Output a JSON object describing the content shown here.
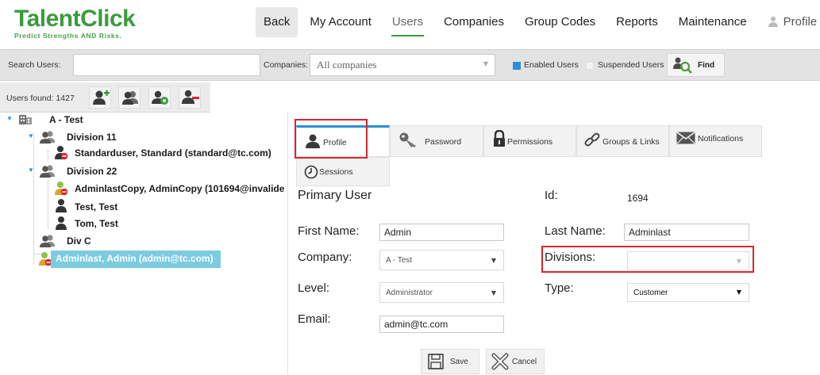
{
  "brand": {
    "name": "TalentClick",
    "tagline": "Predict Strengths AND Risks."
  },
  "nav": {
    "back": "Back",
    "items": [
      "My Account",
      "Users",
      "Companies",
      "Group Codes",
      "Reports",
      "Maintenance"
    ],
    "active": "Users",
    "profile": "Profile"
  },
  "search": {
    "label": "Search Users:",
    "value": "",
    "companies_label": "Companies:",
    "companies_value": "All companies",
    "enabled_label": "Enabled Users",
    "enabled_checked": true,
    "suspended_label": "Suspended Users",
    "suspended_checked": false,
    "find_label": "Find"
  },
  "users_found": "Users found: 1427",
  "toolbar_icons": [
    "add-user-icon",
    "users-icon",
    "user-settings-icon",
    "remove-user-icon"
  ],
  "tree": {
    "root": "A - Test",
    "divisions": [
      {
        "name": "Division 11",
        "users": [
          "Standarduser, Standard  (standard@tc.com)"
        ]
      },
      {
        "name": "Division 22",
        "users": [
          "AdminlastCopy, AdminCopy  (101694@invalide",
          "Test, Test",
          "Tom, Test"
        ]
      },
      {
        "name": "Div C",
        "users": []
      }
    ],
    "selected": "Adminlast, Admin  (admin@tc.com)"
  },
  "tabs": [
    "Profile",
    "Password",
    "Permissions",
    "Groups & Links",
    "Notifications",
    "Sessions"
  ],
  "active_tab": "Profile",
  "form": {
    "section_title": "Primary User",
    "id_label": "Id:",
    "id_value": "1694",
    "first_name_label": "First Name:",
    "first_name": "Admin",
    "last_name_label": "Last Name:",
    "last_name": "Adminlast",
    "company_label": "Company:",
    "company": "A - Test",
    "divisions_label": "Divisions:",
    "divisions": "",
    "level_label": "Level:",
    "level": "Administrator",
    "type_label": "Type:",
    "type": "Customer",
    "email_label": "Email:",
    "email": "admin@tc.com"
  },
  "buttons": {
    "save": "Save",
    "cancel": "Cancel"
  },
  "colors": {
    "brand_green": "#3b9b3b",
    "accent_blue": "#2a8fd6",
    "selection": "#7bcbe1",
    "highlight_red": "#d9262c"
  }
}
